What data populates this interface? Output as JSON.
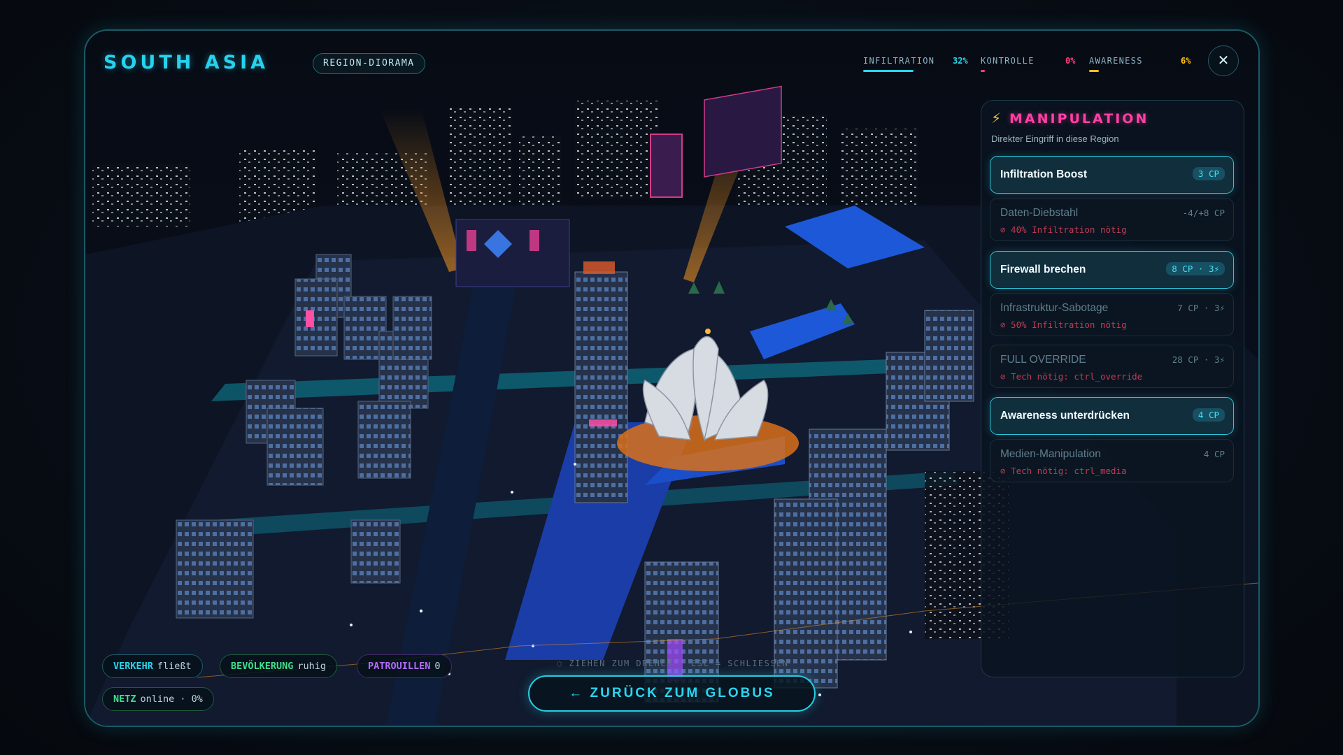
{
  "header": {
    "region_title": "SOUTH ASIA",
    "badge": "REGION-DIORAMA",
    "stats": [
      {
        "label": "INFILTRATION",
        "value": "32%",
        "color": "#28d6ee",
        "fraction": 0.32
      },
      {
        "label": "KONTROLLE",
        "value": "0%",
        "color": "#ff3f7f",
        "fraction": 0.0
      },
      {
        "label": "AWARENESS",
        "value": "6%",
        "color": "#ffc21a",
        "fraction": 0.06
      }
    ],
    "close_label": "✕"
  },
  "panel": {
    "icon": "lightning-icon",
    "title": "MANIPULATION",
    "subtitle": "Direkter Eingriff in diese Region",
    "actions": [
      {
        "label": "Infiltration Boost",
        "cost": "3 CP",
        "enabled": true,
        "requirement": ""
      },
      {
        "label": "Daten-Diebstahl",
        "cost": "-4/+8 CP",
        "enabled": false,
        "requirement": "⊘ 40% Infiltration nötig"
      },
      {
        "label": "Firewall brechen",
        "cost": "8 CP · 3⚡",
        "enabled": true,
        "requirement": ""
      },
      {
        "label": "Infrastruktur-Sabotage",
        "cost": "7 CP · 3⚡",
        "enabled": false,
        "requirement": "⊘ 50% Infiltration nötig"
      },
      {
        "label": "FULL OVERRIDE",
        "cost": "28 CP · 3⚡",
        "enabled": false,
        "requirement": "⊘ Tech nötig: ctrl_override"
      },
      {
        "label": "Awareness unterdrücken",
        "cost": "4 CP",
        "enabled": true,
        "requirement": ""
      },
      {
        "label": "Medien-Manipulation",
        "cost": "4 CP",
        "enabled": false,
        "requirement": "⊘ Tech nötig: ctrl_media"
      }
    ]
  },
  "hud": {
    "traffic": {
      "key": "VERKEHR",
      "value": "fließt"
    },
    "population": {
      "key": "BEVÖLKERUNG",
      "value": "ruhig"
    },
    "patrols": {
      "key": "PATROUILLEN",
      "value": "0"
    },
    "network": {
      "key": "NETZ",
      "value": "online · 0%"
    },
    "hint": "◌ ZIEHEN ZUM DREHEN · ESC = SCHLIESSEN",
    "back_button": "← ZURÜCK ZUM GLOBUS"
  },
  "colors": {
    "accent": "#28d6ee",
    "manipulation": "#ff3fa4",
    "kontrolle": "#ff3f7f",
    "awareness": "#ffc21a",
    "population": "#3fe08a",
    "patrols": "#b46bff"
  }
}
